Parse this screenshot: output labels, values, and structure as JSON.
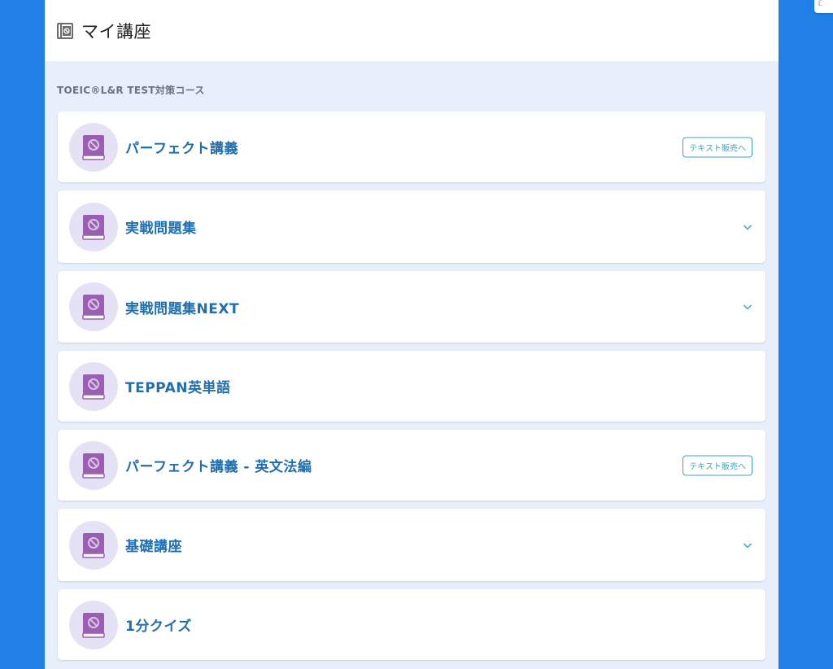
{
  "header": {
    "title": "マイ講座",
    "icon": "course-book-icon"
  },
  "section": {
    "label": "TOEIC®L&R TEST対策コース"
  },
  "courses": [
    {
      "label": "パーフェクト講義",
      "action": "テキスト販売へ"
    },
    {
      "label": "実戦問題集",
      "expandable": true
    },
    {
      "label": "実戦問題集NEXT",
      "expandable": true
    },
    {
      "label": "TEPPAN英単語"
    },
    {
      "label": "パーフェクト講義 - 英文法編",
      "action": "テキスト販売へ"
    },
    {
      "label": "基礎講座",
      "expandable": true
    },
    {
      "label": "1分クイズ"
    }
  ],
  "colors": {
    "background": "#2080e6",
    "panel": "#e8eefa",
    "course_title": "#1f6fb0",
    "book_icon": "#9a5fb0",
    "icon_circle": "#e6e2f5",
    "button_border": "#3fa4b8"
  }
}
